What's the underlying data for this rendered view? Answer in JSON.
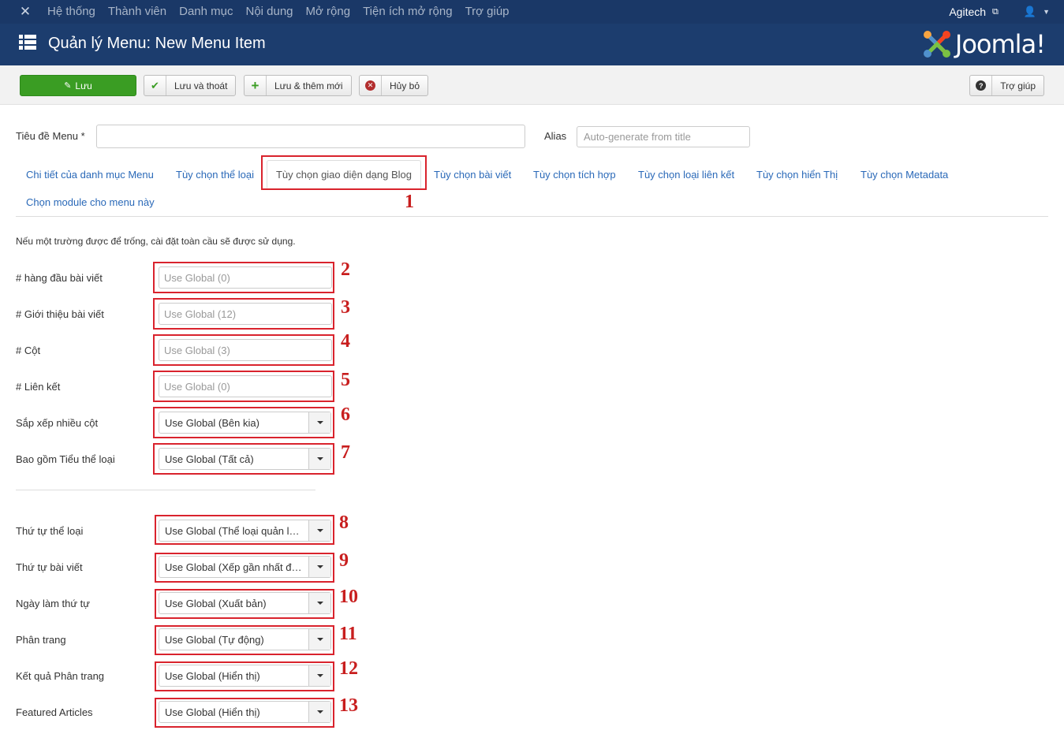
{
  "topnav": {
    "items": [
      "Hệ thống",
      "Thành viên",
      "Danh mục",
      "Nội dung",
      "Mở rộng",
      "Tiện ích mở rộng",
      "Trợ giúp"
    ],
    "user": "Agitech"
  },
  "header": {
    "title": "Quản lý Menu: New Menu Item",
    "brand": "Joomla!"
  },
  "toolbar": {
    "save": "Lưu",
    "save_close": "Lưu và thoát",
    "save_new": "Lưu & thêm mới",
    "cancel": "Hủy bỏ",
    "help": "Trợ giúp"
  },
  "form": {
    "menu_title_label": "Tiêu đề Menu *",
    "menu_title_value": "",
    "alias_label": "Alias",
    "alias_placeholder": "Auto-generate from title"
  },
  "tabs": [
    "Chi tiết của danh mục Menu",
    "Tùy chọn thể loại",
    "Tùy chọn giao diện dạng Blog",
    "Tùy chọn bài viết",
    "Tùy chọn tích hợp",
    "Tùy chọn loại liên kết",
    "Tùy chọn hiển Thị",
    "Tùy chọn Metadata",
    "Chọn module cho menu này"
  ],
  "note": "Nếu một trường được để trống, cài đặt toàn cầu sẽ được sử dụng.",
  "fields": [
    {
      "label": "# hàng đầu bài viết",
      "placeholder": "Use Global (0)",
      "num": "2"
    },
    {
      "label": "# Giới thiệu bài viết",
      "placeholder": "Use Global (12)",
      "num": "3"
    },
    {
      "label": "# Cột",
      "placeholder": "Use Global (3)",
      "num": "4"
    },
    {
      "label": "# Liên kết",
      "placeholder": "Use Global (0)",
      "num": "5"
    }
  ],
  "selects": [
    {
      "label": "Sắp xếp nhiều cột",
      "value": "Use Global (Bên kia)",
      "num": "6"
    },
    {
      "label": "Bao gồm Tiểu thể loại",
      "value": "Use Global (Tất cả)",
      "num": "7"
    },
    {
      "label": "Thứ tự thể loại",
      "value": "Use Global (Thể loại quản lý Thứ tự)",
      "num": "8"
    },
    {
      "label": "Thứ tự bài viết",
      "value": "Use Global (Xếp gần nhất đầu tiên)",
      "num": "9"
    },
    {
      "label": "Ngày làm thứ tự",
      "value": "Use Global (Xuất bản)",
      "num": "10"
    },
    {
      "label": "Phân trang",
      "value": "Use Global (Tự động)",
      "num": "11"
    },
    {
      "label": "Kết quả Phân trang",
      "value": "Use Global (Hiển thị)",
      "num": "12"
    },
    {
      "label": "Featured Articles",
      "value": "Use Global (Hiển thị)",
      "num": "13"
    }
  ],
  "tab_marker": "1",
  "colors": {
    "topnav_bg": "#1a3867",
    "header_bg": "#1c3d6e",
    "save_green": "#3a9d23",
    "link_blue": "#2a69b8",
    "annotation_red": "#d9232d"
  }
}
